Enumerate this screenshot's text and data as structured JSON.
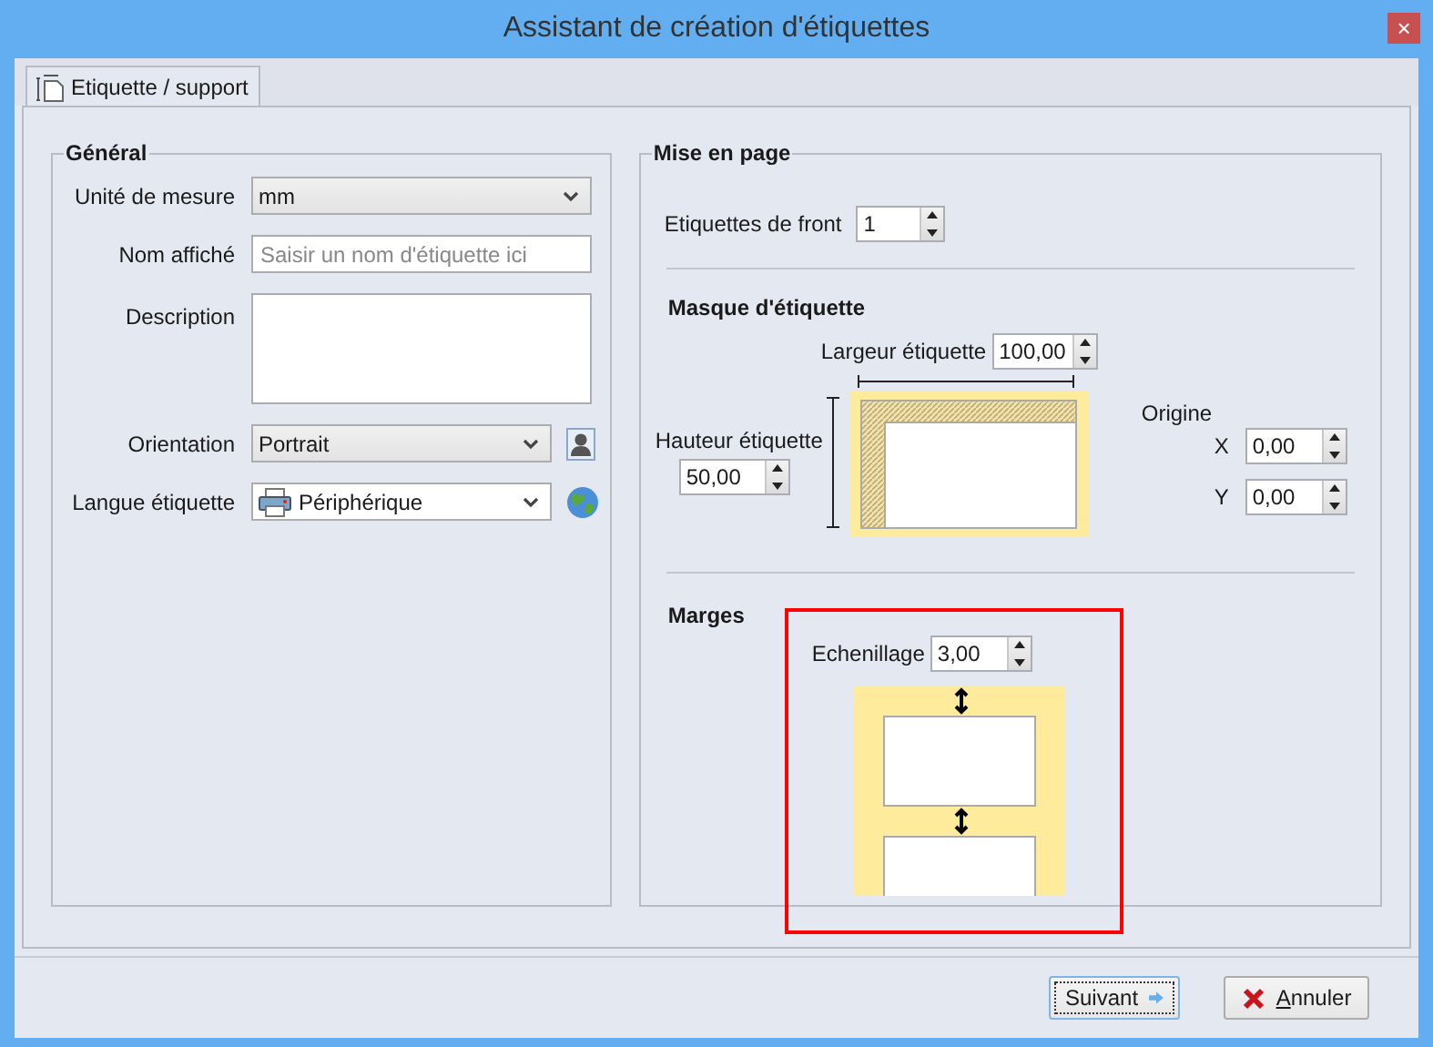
{
  "window": {
    "title": "Assistant de création d'étiquettes",
    "close_glyph": "×"
  },
  "tabs": [
    {
      "label": "Etiquette / support",
      "selected": true
    }
  ],
  "general": {
    "title": "Général",
    "fields": [
      {
        "kind": "combo",
        "label": "Unité de mesure",
        "value": "mm"
      },
      {
        "kind": "text",
        "label": "Nom affiché",
        "placeholder": "Saisir un nom d'étiquette ici"
      },
      {
        "kind": "memo",
        "label": "Description"
      },
      {
        "kind": "combo-button",
        "label": "Orientation",
        "value": "Portrait"
      },
      {
        "kind": "device-combo",
        "label": "Langue étiquette",
        "value": "Périphérique"
      }
    ]
  },
  "layout": {
    "title": "Mise en page",
    "front": {
      "label": "Etiquettes de front",
      "value": "1"
    },
    "mask": {
      "title": "Masque d'étiquette",
      "width": {
        "label": "Largeur étiquette",
        "value": "100,00"
      },
      "height": {
        "label": "Hauteur étiquette",
        "value": "50,00"
      },
      "origin": {
        "title": "Origine",
        "x": {
          "label": "X",
          "value": "0,00"
        },
        "y": {
          "label": "Y",
          "value": "0,00"
        }
      }
    },
    "margins": {
      "title": "Marges",
      "gap": {
        "label": "Echenillage",
        "value": "3,00"
      }
    }
  },
  "buttons": [
    {
      "kind": "next",
      "label": "Suivant",
      "focused": true,
      "mnemonic": false
    },
    {
      "kind": "cancel",
      "label": "Annuler",
      "focused": false,
      "mnemonic": true
    }
  ]
}
